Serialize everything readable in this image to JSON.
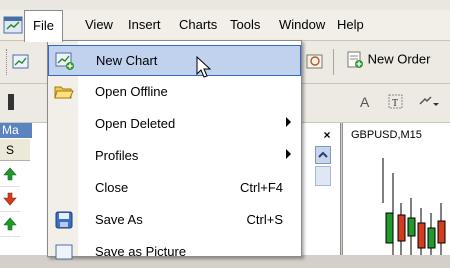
{
  "menubar": {
    "items": [
      {
        "label": "File",
        "active": true
      },
      {
        "label": "View"
      },
      {
        "label": "Insert"
      },
      {
        "label": "Charts"
      },
      {
        "label": "Tools"
      },
      {
        "label": "Window"
      },
      {
        "label": "Help"
      }
    ]
  },
  "toolbar": {
    "new_order_label": "New Order",
    "text_tool_label": "A"
  },
  "market_watch": {
    "panel_title": "Ma",
    "column_header": "S"
  },
  "chart": {
    "symbol_label": "GBPUSD,M15"
  },
  "file_menu": {
    "items": [
      {
        "label": "New Chart",
        "shortcut": "",
        "submenu": false,
        "icon": "new-chart-icon",
        "highlighted": true
      },
      {
        "label": "Open Offline",
        "shortcut": "",
        "submenu": false,
        "icon": "open-folder-icon"
      },
      {
        "label": "Open Deleted",
        "shortcut": "",
        "submenu": true
      },
      {
        "label": "Profiles",
        "shortcut": "",
        "submenu": true
      },
      {
        "label": "Close",
        "shortcut": "Ctrl+F4",
        "submenu": false
      },
      {
        "label": "Save As",
        "shortcut": "Ctrl+S",
        "submenu": false,
        "icon": "save-icon"
      },
      {
        "label": "Save as Picture",
        "shortcut": "",
        "submenu": false
      }
    ]
  },
  "colors": {
    "highlight_bg": "#c1d2ee",
    "highlight_border": "#316ac5",
    "panel_header": "#5a83c0",
    "up_arrow": "#1f9a2b",
    "down_arrow": "#d43c1e"
  }
}
